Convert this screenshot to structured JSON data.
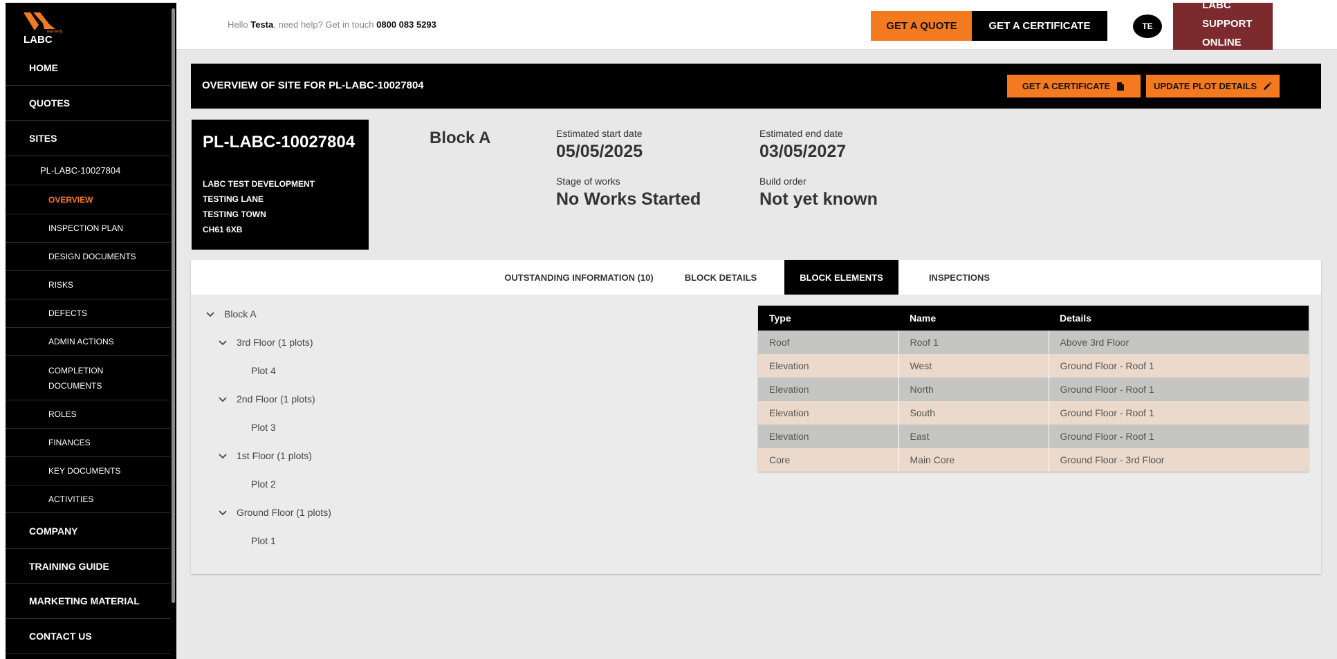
{
  "brand": {
    "logo_text": "LABC",
    "logo_small": "warranty",
    "accent": "#f47a20",
    "support_color": "#7c2a2d"
  },
  "sidebar": {
    "home": "HOME",
    "quotes": "QUOTES",
    "sites": "SITES",
    "site_ref": "PL-LABC-10027804",
    "sub_items": [
      "OVERVIEW",
      "INSPECTION PLAN",
      "DESIGN DOCUMENTS",
      "RISKS",
      "DEFECTS",
      "ADMIN ACTIONS",
      "COMPLETION",
      "DOCUMENTS",
      "ROLES",
      "FINANCES",
      "KEY DOCUMENTS",
      "ACTIVITIES"
    ],
    "company": "COMPANY",
    "training": "TRAINING GUIDE",
    "marketing": "MARKETING MATERIAL",
    "contact": "CONTACT US"
  },
  "topbar": {
    "hello": "Hello ",
    "user": "Testa",
    "help": ", need help? Get in touch ",
    "phone": "0800 083 5293",
    "quote_btn": "GET A QUOTE",
    "certificate_btn": "GET A CERTIFICATE",
    "avatar": "TE",
    "support": [
      "LABC",
      "SUPPORT",
      "ONLINE"
    ]
  },
  "header": {
    "title": "OVERVIEW OF SITE FOR PL-LABC-10027804",
    "cert_btn": "GET A CERTIFICATE",
    "update_btn": "UPDATE PLOT DETAILS"
  },
  "plot": {
    "ref": "PL-LABC-10027804",
    "address": [
      "LABC TEST DEVELOPMENT",
      "TESTING LANE",
      "TESTING TOWN",
      "CH61 6XB"
    ]
  },
  "overview": {
    "block": "Block A",
    "start_label": "Estimated start date",
    "start_value": "05/05/2025",
    "end_label": "Estimated end date",
    "end_value": "03/05/2027",
    "stage_label": "Stage of works",
    "stage_value": "No Works Started",
    "order_label": "Build order",
    "order_value": "Not yet known"
  },
  "tabs": [
    {
      "label": "OUTSTANDING INFORMATION (10)"
    },
    {
      "label": "BLOCK DETAILS"
    },
    {
      "label": "BLOCK ELEMENTS"
    },
    {
      "label": "INSPECTIONS"
    }
  ],
  "tree": {
    "block": "Block A",
    "floors": [
      {
        "label": "3rd Floor (1 plots)",
        "plot": "Plot 4"
      },
      {
        "label": "2nd Floor (1 plots)",
        "plot": "Plot 3"
      },
      {
        "label": "1st Floor (1 plots)",
        "plot": "Plot 2"
      },
      {
        "label": "Ground Floor (1 plots)",
        "plot": "Plot 1"
      }
    ]
  },
  "elements": {
    "headers": [
      "Type",
      "Name",
      "Details"
    ],
    "rows": [
      [
        "Roof",
        "Roof 1",
        "Above 3rd Floor"
      ],
      [
        "Elevation",
        "West",
        "Ground Floor - Roof 1"
      ],
      [
        "Elevation",
        "North",
        "Ground Floor - Roof 1"
      ],
      [
        "Elevation",
        "South",
        "Ground Floor - Roof 1"
      ],
      [
        "Elevation",
        "East",
        "Ground Floor - Roof 1"
      ],
      [
        "Core",
        "Main Core",
        "Ground Floor - 3rd Floor"
      ]
    ]
  }
}
